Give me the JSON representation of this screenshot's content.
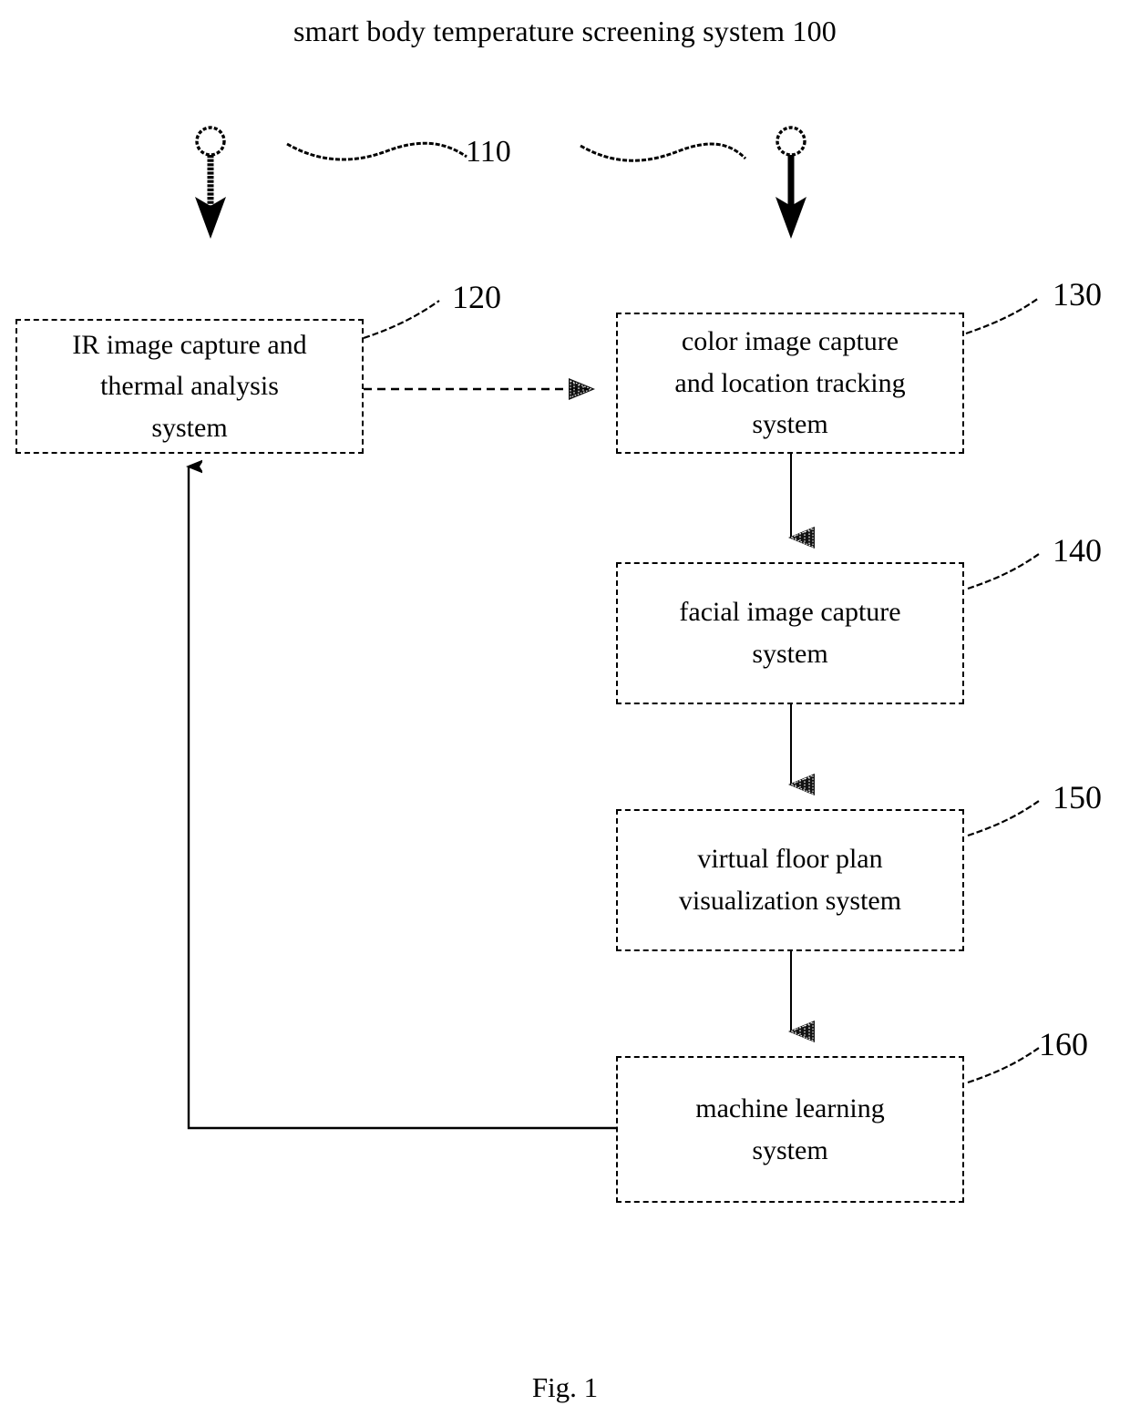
{
  "figure": {
    "title": "smart body temperature screening system 100",
    "caption": "Fig. 1"
  },
  "labels": {
    "scene_110": "110",
    "ref_120": "120",
    "ref_130": "130",
    "ref_140": "140",
    "ref_150": "150",
    "ref_160": "160"
  },
  "blocks": [
    {
      "id": "120",
      "line1": "IR image capture and",
      "line2": "thermal analysis",
      "line3": "system"
    },
    {
      "id": "130",
      "line1": "color image capture",
      "line2": "and location tracking",
      "line3": "system"
    },
    {
      "id": "140",
      "line1": "facial image capture",
      "line2": "system",
      "line3": ""
    },
    {
      "id": "150",
      "line1": "virtual floor plan",
      "line2": "visualization system",
      "line3": ""
    },
    {
      "id": "160",
      "line1": "machine learning",
      "line2": "system",
      "line3": ""
    }
  ],
  "colors": {
    "ink": "#000000",
    "paper": "#ffffff"
  }
}
